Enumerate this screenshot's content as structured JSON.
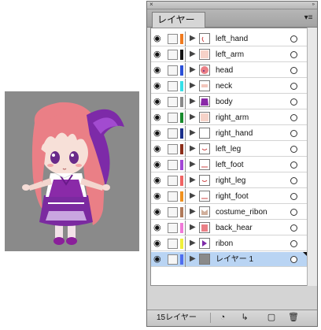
{
  "panel": {
    "tab_label": "レイヤー",
    "layer_count": "15レイヤー"
  },
  "layers": [
    {
      "name": "left_hand",
      "color": "#f07a1e",
      "thumb": "hand",
      "visible": true
    },
    {
      "name": "left_arm",
      "color": "#111111",
      "thumb": "arm",
      "visible": true
    },
    {
      "name": "head",
      "color": "#2a4fd8",
      "thumb": "head",
      "visible": true
    },
    {
      "name": "neck",
      "color": "#36e0e8",
      "thumb": "neck",
      "visible": true
    },
    {
      "name": "body",
      "color": "#8a8a8a",
      "thumb": "body",
      "visible": true
    },
    {
      "name": "right_arm",
      "color": "#178a2c",
      "thumb": "arm",
      "visible": true
    },
    {
      "name": "right_hand",
      "color": "#1a2f8a",
      "thumb": "blank",
      "visible": true
    },
    {
      "name": "left_leg",
      "color": "#8c2e1a",
      "thumb": "leg",
      "visible": true
    },
    {
      "name": "left_foot",
      "color": "#a246d6",
      "thumb": "foot",
      "visible": true
    },
    {
      "name": "right_leg",
      "color": "#f06464",
      "thumb": "leg",
      "visible": true
    },
    {
      "name": "right_foot",
      "color": "#f0911e",
      "thumb": "foot",
      "visible": true
    },
    {
      "name": "costume_ribon",
      "color": "#b07a5a",
      "thumb": "ribbon",
      "visible": true
    },
    {
      "name": "back_hear",
      "color": "#f07ad8",
      "thumb": "hair",
      "visible": true
    },
    {
      "name": "ribon",
      "color": "#f0f03a",
      "thumb": "ribbon2",
      "visible": true
    },
    {
      "name": "レイヤー 1",
      "color": "#4f6ef0",
      "thumb": "gray",
      "visible": true,
      "selected": true
    }
  ],
  "icons": {
    "eye": "eye-icon",
    "expand": "triangle-right-icon",
    "target": "target-circle-icon",
    "panel_menu": "panel-menu-icon",
    "footer": [
      "make-clipping-mask-icon",
      "new-sublayer-icon",
      "new-layer-icon",
      "trash-icon"
    ]
  }
}
